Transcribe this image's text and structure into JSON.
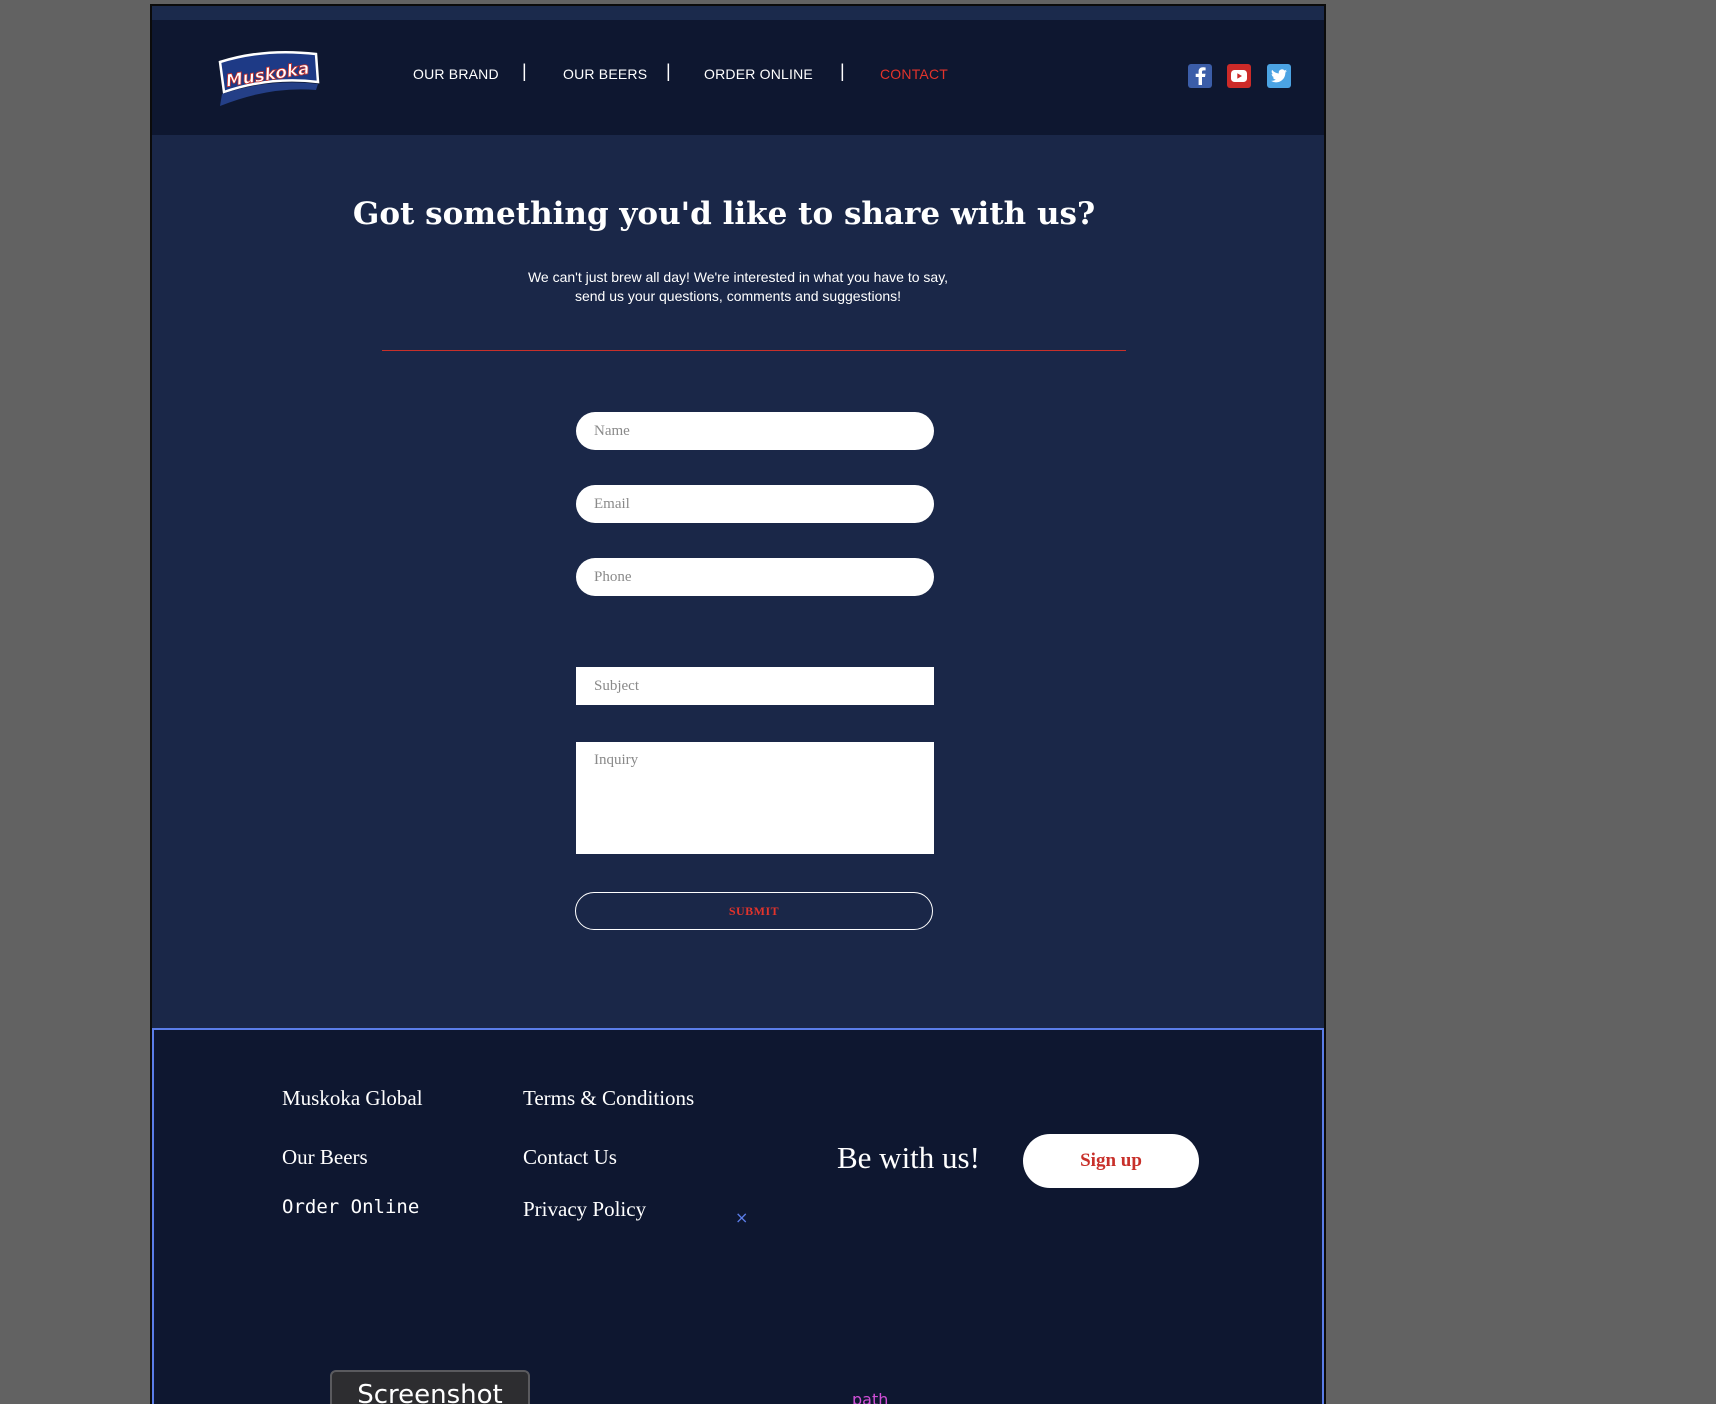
{
  "header": {
    "logo_text": "Muskoka",
    "nav": [
      {
        "label": "OUR BRAND"
      },
      {
        "label": "OUR BEERS"
      },
      {
        "label": "ORDER ONLINE"
      },
      {
        "label": "CONTACT",
        "active": true
      }
    ],
    "separator": "|",
    "social": [
      "facebook-icon",
      "youtube-icon",
      "twitter-icon"
    ]
  },
  "main": {
    "title": "Got something you'd like to share with us?",
    "subtitle_line1": "We can't just brew all day!  We're interested in what you have to say,",
    "subtitle_line2": "send us your questions, comments and suggestions!",
    "form": {
      "name_placeholder": "Name",
      "email_placeholder": "Email",
      "phone_placeholder": "Phone",
      "subject_placeholder": "Subject",
      "inquiry_placeholder": "Inquiry",
      "submit_label": "SUBMIT"
    }
  },
  "footer": {
    "col1": [
      "Muskoka Global",
      "Our Beers",
      "Order Online"
    ],
    "col2": [
      "Terms & Conditions",
      "Contact Us",
      "Privacy Policy"
    ],
    "cta_text": "Be with us!",
    "signup_label": "Sign up",
    "close_glyph": "×"
  },
  "overlay": {
    "screenshot_label": "Screenshot",
    "path_label": "path"
  },
  "colors": {
    "accent_red": "#e2332b",
    "page_bg": "#1a2748",
    "header_bg": "#0e1730",
    "selection_outline": "#5b7de8"
  }
}
